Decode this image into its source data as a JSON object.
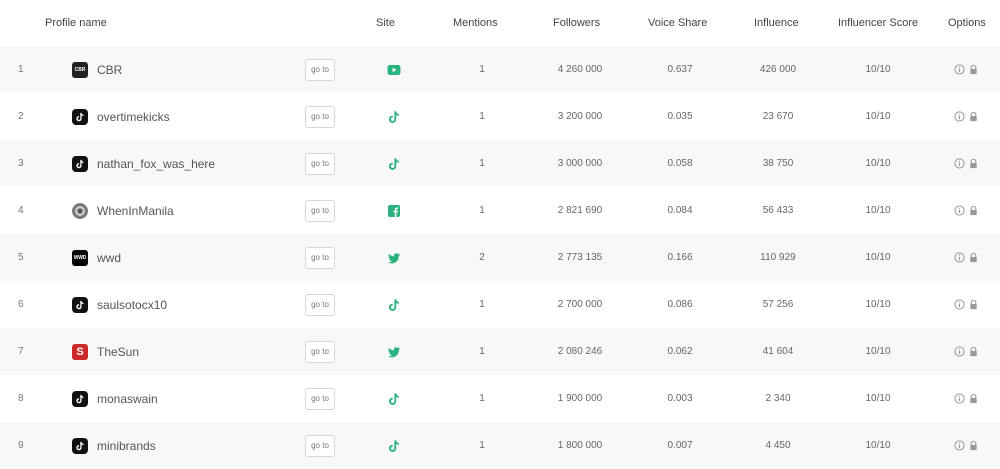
{
  "header": {
    "profile_name": "Profile name",
    "site": "Site",
    "mentions": "Mentions",
    "followers": "Followers",
    "voice_share": "Voice Share",
    "influence": "Influence",
    "influencer_score": "Influencer Score",
    "options": "Options"
  },
  "goto_label": "go to",
  "colors": {
    "site_icon": "#2bb37f",
    "option_icon": "#999999",
    "row_alt": "#f8f8f8"
  },
  "rows": [
    {
      "num": "1",
      "name": "CBR",
      "avatar": "cbr",
      "avatar_text": "CBR",
      "site": "youtube-icon",
      "mentions": "1",
      "followers": "4 260 000",
      "voice_share": "0.637",
      "influence": "426 000",
      "score": "10/10"
    },
    {
      "num": "2",
      "name": "overtimekicks",
      "avatar": "tiktok",
      "avatar_text": "",
      "site": "tiktok-icon",
      "mentions": "1",
      "followers": "3 200 000",
      "voice_share": "0.035",
      "influence": "23 670",
      "score": "10/10"
    },
    {
      "num": "3",
      "name": "nathan_fox_was_here",
      "avatar": "tiktok",
      "avatar_text": "",
      "site": "tiktok-icon",
      "mentions": "1",
      "followers": "3 000 000",
      "voice_share": "0.058",
      "influence": "38 750",
      "score": "10/10"
    },
    {
      "num": "4",
      "name": "WhenInManila",
      "avatar": "round",
      "avatar_text": "",
      "site": "facebook-icon",
      "mentions": "1",
      "followers": "2 821 690",
      "voice_share": "0.084",
      "influence": "56 433",
      "score": "10/10"
    },
    {
      "num": "5",
      "name": "wwd",
      "avatar": "wwd",
      "avatar_text": "WWD",
      "site": "twitter-icon",
      "mentions": "2",
      "followers": "2 773 135",
      "voice_share": "0.166",
      "influence": "110 929",
      "score": "10/10"
    },
    {
      "num": "6",
      "name": "saulsotocx10",
      "avatar": "tiktok",
      "avatar_text": "",
      "site": "tiktok-icon",
      "mentions": "1",
      "followers": "2 700 000",
      "voice_share": "0.086",
      "influence": "57 256",
      "score": "10/10"
    },
    {
      "num": "7",
      "name": "TheSun",
      "avatar": "red",
      "avatar_text": "S",
      "site": "twitter-icon",
      "mentions": "1",
      "followers": "2 080 246",
      "voice_share": "0.062",
      "influence": "41 604",
      "score": "10/10"
    },
    {
      "num": "8",
      "name": "monaswain",
      "avatar": "tiktok",
      "avatar_text": "",
      "site": "tiktok-icon",
      "mentions": "1",
      "followers": "1 900 000",
      "voice_share": "0.003",
      "influence": "2 340",
      "score": "10/10"
    },
    {
      "num": "9",
      "name": "minibrands",
      "avatar": "tiktok",
      "avatar_text": "",
      "site": "tiktok-icon",
      "mentions": "1",
      "followers": "1 800 000",
      "voice_share": "0.007",
      "influence": "4 450",
      "score": "10/10"
    }
  ]
}
